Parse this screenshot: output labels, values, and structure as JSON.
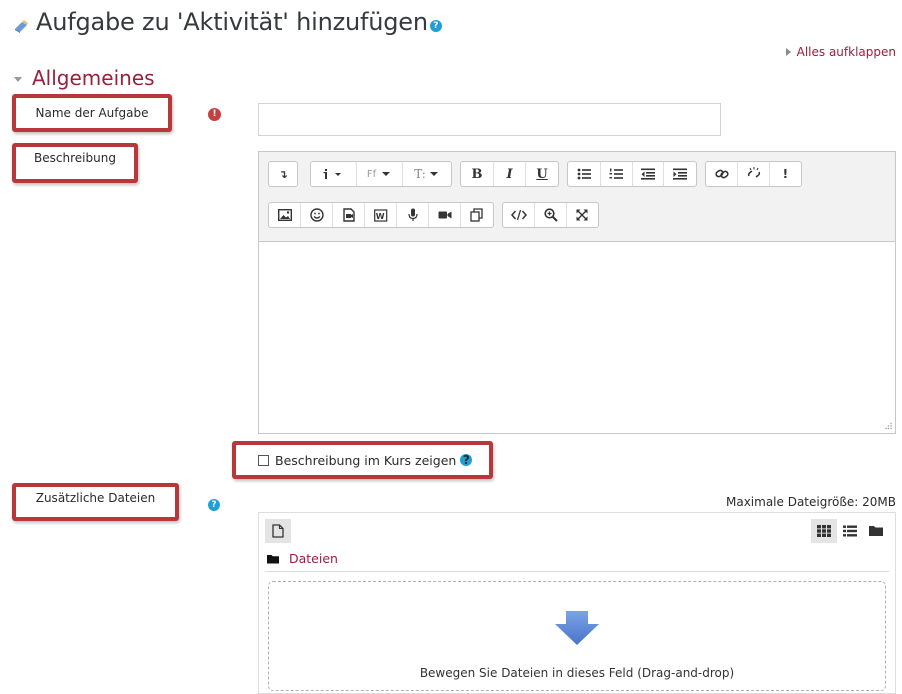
{
  "page": {
    "title": "Aufgabe zu 'Aktivität' hinzufügen",
    "help_glyph": "?",
    "expand_all": "Alles aufklappen"
  },
  "section": {
    "title": "Allgemeines"
  },
  "fields": {
    "name_label": "Name der Aufgabe",
    "required_glyph": "!",
    "name_value": "",
    "description_label": "Beschreibung",
    "show_description_label": "Beschreibung im Kurs zeigen",
    "show_description_checked": false,
    "files_label": "Zusätzliche Dateien",
    "max_size": "Maximale Dateigröße: 20MB"
  },
  "editor": {
    "toolbar_row1": [
      "collapse-icon",
      "info-dropdown-icon",
      "font-family-dropdown-icon",
      "font-size-dropdown-icon",
      "bold-icon",
      "italic-icon",
      "underline-icon",
      "unordered-list-icon",
      "ordered-list-icon",
      "outdent-icon",
      "indent-icon",
      "link-icon",
      "unlink-icon",
      "accessibility-checker-icon"
    ],
    "toolbar_row2": [
      "image-icon",
      "emoji-icon",
      "media-icon",
      "word-import-icon",
      "record-audio-icon",
      "record-video-icon",
      "manage-files-icon",
      "html-icon",
      "find-icon",
      "fullscreen-icon"
    ],
    "btn_bold": "B",
    "btn_italic": "I",
    "btn_underline": "U",
    "btn_font_family": "Ff",
    "btn_font_size": "T:",
    "btn_collapse": "↴",
    "btn_accessibility": "!"
  },
  "filemanager": {
    "folder_label": "Dateien",
    "drop_text": "Bewegen Sie Dateien in dieses Feld (Drag-and-drop)"
  },
  "colors": {
    "brand": "#9b1e3a",
    "highlight_border": "#b8373b",
    "help": "#1f9fd6",
    "required": "#c5403e",
    "drop_arrow": "#5b86d6"
  }
}
